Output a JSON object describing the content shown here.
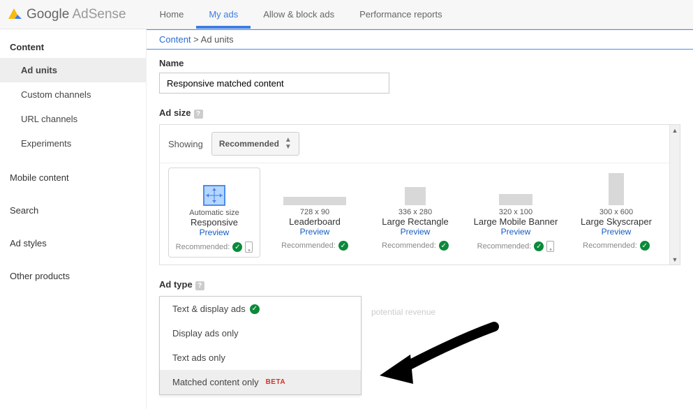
{
  "header": {
    "brand_google": "Google",
    "brand_adsense": " AdSense",
    "tabs": [
      "Home",
      "My ads",
      "Allow & block ads",
      "Performance reports"
    ],
    "active_tab": 1
  },
  "sidebar": {
    "content_heading": "Content",
    "content_items": [
      "Ad units",
      "Custom channels",
      "URL channels",
      "Experiments"
    ],
    "content_active": 0,
    "other": [
      "Mobile content",
      "Search",
      "Ad styles",
      "Other products"
    ]
  },
  "breadcrumb": {
    "root": "Content",
    "current": "Ad units"
  },
  "name": {
    "label": "Name",
    "value": "Responsive matched content"
  },
  "adsize": {
    "label": "Ad size",
    "showing_label": "Showing",
    "dropdown": "Recommended",
    "cards": [
      {
        "small": "Automatic size",
        "big": "Responsive",
        "preview": "Preview",
        "rec": "Recommended:",
        "phone": true
      },
      {
        "small": "728 x 90",
        "big": "Leaderboard",
        "preview": "Preview",
        "rec": "Recommended:",
        "phone": false
      },
      {
        "small": "336 x 280",
        "big": "Large Rectangle",
        "preview": "Preview",
        "rec": "Recommended:",
        "phone": false
      },
      {
        "small": "320 x 100",
        "big": "Large Mobile Banner",
        "preview": "Preview",
        "rec": "Recommended:",
        "phone": true
      },
      {
        "small": "300 x 600",
        "big": "Large Skyscraper",
        "preview": "Preview",
        "rec": "Recommended:",
        "phone": false
      }
    ]
  },
  "adtype": {
    "label": "Ad type",
    "ghost": "potential revenue",
    "options": [
      {
        "label": "Text & display ads",
        "check": true
      },
      {
        "label": "Display ads only"
      },
      {
        "label": "Text ads only"
      },
      {
        "label": "Matched content only",
        "beta": "BETA",
        "active": true
      }
    ]
  }
}
